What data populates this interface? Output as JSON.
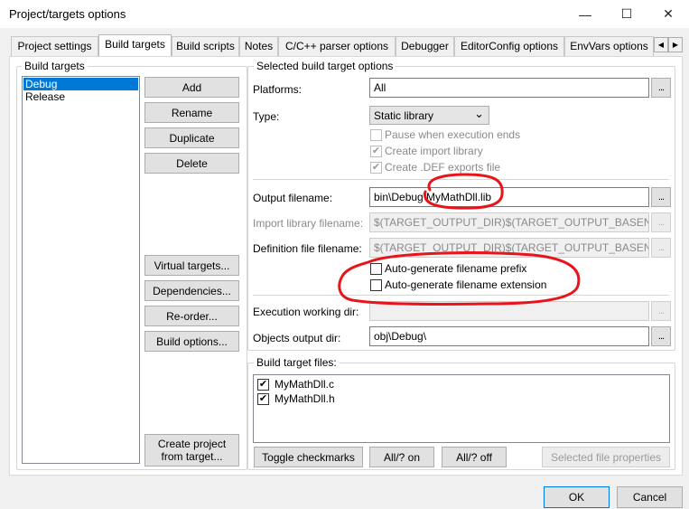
{
  "window": {
    "title": "Project/targets options",
    "minimize_glyph": "—",
    "maximize_glyph": "☐",
    "close_glyph": "✕"
  },
  "tabs": [
    "Project settings",
    "Build targets",
    "Build scripts",
    "Notes",
    "C/C++ parser options",
    "Debugger",
    "EditorConfig options",
    "EnvVars options"
  ],
  "tab_scroll": {
    "left": "◀",
    "right": "▶"
  },
  "build_targets": {
    "group_label": "Build targets",
    "items": [
      "Debug",
      "Release"
    ],
    "selected": "Debug",
    "buttons": {
      "add": "Add",
      "rename": "Rename",
      "duplicate": "Duplicate",
      "delete": "Delete",
      "virtual_targets": "Virtual targets...",
      "dependencies": "Dependencies...",
      "reorder": "Re-order...",
      "build_options": "Build options...",
      "create_project_line1": "Create project",
      "create_project_line2": "from target..."
    }
  },
  "options": {
    "group_label": "Selected build target options",
    "platforms_label": "Platforms:",
    "platforms_value": "All",
    "type_label": "Type:",
    "type_value": "Static library",
    "pause_label": "Pause when execution ends",
    "import_lib_label": "Create import library",
    "def_exports_label": "Create .DEF exports file",
    "output_label": "Output filename:",
    "output_value": "bin\\Debug\\MyMathDll.lib",
    "import_label": "Import library filename:",
    "import_value": "$(TARGET_OUTPUT_DIR)$(TARGET_OUTPUT_BASEN",
    "definition_label": "Definition file filename:",
    "definition_value": "$(TARGET_OUTPUT_DIR)$(TARGET_OUTPUT_BASEN",
    "prefix_label": "Auto-generate filename prefix",
    "extension_label": "Auto-generate filename extension",
    "workdir_label": "Execution working dir:",
    "workdir_value": "",
    "objdir_label": "Objects output dir:",
    "objdir_value": "obj\\Debug\\",
    "ellipsis": "..."
  },
  "files": {
    "group_label": "Build target files:",
    "items": [
      "MyMathDll.c",
      "MyMathDll.h"
    ],
    "toggle": "Toggle checkmarks",
    "all_on": "All/? on",
    "all_off": "All/? off",
    "properties": "Selected file properties"
  },
  "footer": {
    "ok": "OK",
    "cancel": "Cancel"
  },
  "glyphs": {
    "check": "✔",
    "dropdown": "⌄"
  },
  "annotation_color": "#e8141b"
}
